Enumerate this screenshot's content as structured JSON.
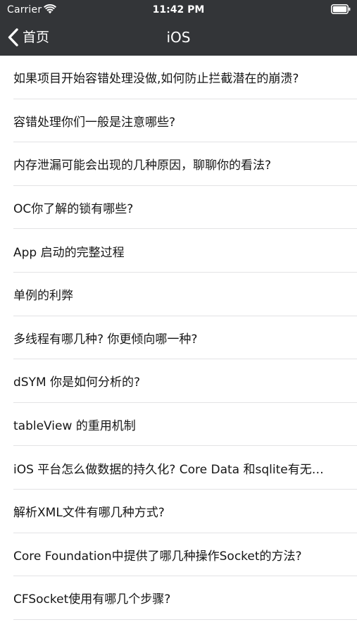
{
  "status_bar": {
    "carrier": "Carrier",
    "time": "11:42 PM",
    "wifi_icon": "wifi-icon",
    "battery_icon": "battery-icon"
  },
  "nav_bar": {
    "back_label": "首页",
    "back_icon": "chevron-left-icon",
    "title": "iOS",
    "background_color": "#333538",
    "text_color": "#ffffff"
  },
  "list": {
    "items": [
      "如果项目开始容错处理没做,如何防止拦截潜在的崩溃?",
      "容错处理你们一般是注意哪些?",
      "内存泄漏可能会出现的几种原因，聊聊你的看法?",
      "OC你了解的锁有哪些?",
      "App 启动的完整过程",
      "单例的利弊",
      "多线程有哪几种? 你更倾向哪一种?",
      "dSYM 你是如何分析的?",
      "tableView 的重用机制",
      "iOS 平台怎么做数据的持久化? Core Data 和sqlite有无…",
      "解析XML文件有哪几种方式?",
      "Core Foundation中提供了哪几种操作Socket的方法?",
      "CFSocket使用有哪几个步骤?"
    ]
  }
}
